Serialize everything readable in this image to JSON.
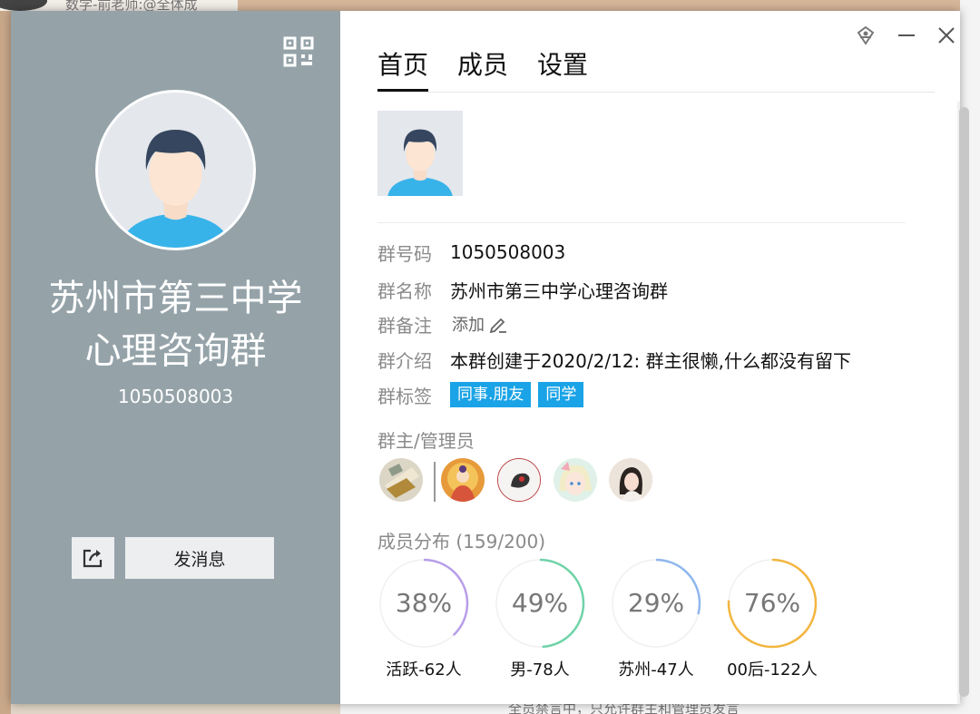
{
  "background": {
    "top_text": "数学-前老师:@全体成",
    "bottom_text": "全员禁言中，只允许群主和管理员发言"
  },
  "left_panel": {
    "group_name_line1": "苏州市第三中学",
    "group_name_line2": "心理咨询群",
    "group_id": "1050508003",
    "send_button": "发消息",
    "icons": {
      "qr": "qr-code-icon",
      "share": "share-icon"
    }
  },
  "window_controls": {
    "pin": "pin-icon",
    "minimize": "minimize-icon",
    "close": "close-icon"
  },
  "tabs": [
    {
      "label": "首页",
      "active": true
    },
    {
      "label": "成员",
      "active": false
    },
    {
      "label": "设置",
      "active": false
    }
  ],
  "info": {
    "number": {
      "label": "群号码",
      "value": "1050508003"
    },
    "name": {
      "label": "群名称",
      "value": "苏州市第三中学心理咨询群"
    },
    "remark": {
      "label": "群备注",
      "value": "添加"
    },
    "intro": {
      "label": "群介绍",
      "value": "本群创建于2020/2/12:  群主很懒,什么都没有留下"
    },
    "tags": {
      "label": "群标签",
      "items": [
        "同事.朋友",
        "同学"
      ]
    }
  },
  "admins": {
    "label": "群主/管理员",
    "count": 5
  },
  "distribution": {
    "label": "成员分布",
    "count": "(159/200)",
    "stats": [
      {
        "percent": "38%",
        "fraction": 0.38,
        "label": "活跃-62人",
        "color": "#b79ee8"
      },
      {
        "percent": "49%",
        "fraction": 0.49,
        "label": "男-78人",
        "color": "#6fd3a8"
      },
      {
        "percent": "29%",
        "fraction": 0.29,
        "label": "苏州-47人",
        "color": "#8fb7ee"
      },
      {
        "percent": "76%",
        "fraction": 0.76,
        "label": "00后-122人",
        "color": "#f3b53f"
      }
    ]
  },
  "colors": {
    "left_panel": "#95a3a9",
    "tag": "#1aa3e6"
  }
}
